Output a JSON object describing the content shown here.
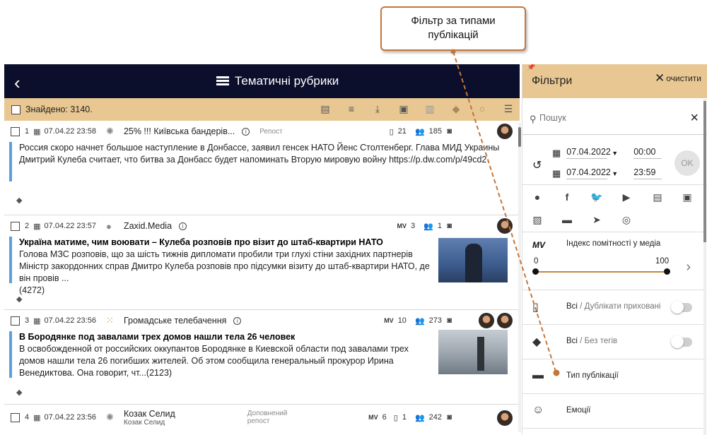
{
  "callout": {
    "line1": "Фільтр за типами",
    "line2": "публікацій"
  },
  "topbar": {
    "back": "‹",
    "title": "Тематичні рубрики"
  },
  "toolbar": {
    "found": "Знайдено: 3140."
  },
  "items": [
    {
      "num": "1",
      "date": "07.04.22 23:58",
      "source": "25% !!! Київська бандерів...",
      "repost": "Репост",
      "stat1": "21",
      "stat2": "185",
      "text": "Россия скоро начнет большое наступление в Донбассе, заявил генсек НАТО Йенс Столтенберг. Глава МИД Украины Дмитрий Кулеба считает, что битва за Донбасс будет напоминать Вторую мировую войну https://p.dw.com/p/49cd2"
    },
    {
      "num": "2",
      "date": "07.04.22 23:57",
      "source": "Zaxid.Media",
      "mv_label": "MV",
      "stat1": "3",
      "stat2": "1",
      "title": "Україна матиме, чим воювати – Кулеба розповів про візит до штаб-квартири НАТО",
      "text": "Голова МЗС розповів, що за шість тижнів дипломати пробили три глухі стіни західних партнерів Міністр закордонних справ Дмитро Кулеба розповів про підсумки візиту до штаб-квартири НАТО, де він провів ...",
      "count": "(4272)"
    },
    {
      "num": "3",
      "date": "07.04.22 23:56",
      "source": "Громадське телебачення",
      "mv_label": "MV",
      "stat1": "10",
      "stat2": "273",
      "title": "В Бородянке под завалами трех домов нашли тела 26 человек",
      "text": "В освобожденной от российских оккупантов Бородянке в Киевской области под завалами трех домов нашли тела 26 погибших жителей. Об этом сообщила генеральный прокурор Ирина Венедиктова. Она говорит, чт...(2123)"
    },
    {
      "num": "4",
      "date": "07.04.22 23:56",
      "source": "Козак Селид",
      "source2": "Козак Селид",
      "repost": "Доповнений",
      "repost2": "репост",
      "mv_label": "MV",
      "stat0": "6",
      "stat1": "1",
      "stat2": "242"
    }
  ],
  "filters": {
    "title": "Фільтри",
    "clear": "очистити",
    "search_placeholder": "Пошук",
    "date_from": "07.04.2022",
    "time_from": "00:00",
    "date_to": "07.04.2022",
    "time_to": "23:59",
    "ok": "OK",
    "mv_badge": "MV",
    "mv_label": "Індекс помітності у медіа",
    "mv_min": "0",
    "mv_max": "100",
    "mv_range": [
      0,
      100
    ],
    "dup_all": "Всі",
    "dup_sub": "/ Дублікати приховані",
    "tags_all": "Всі",
    "tags_sub": "/ Без тегів",
    "pub_type": "Тип публікації",
    "emotions": "Емоції"
  },
  "colors": {
    "accent": "#e8c792",
    "topbar": "#0b0f2c",
    "callout_border": "#c4763a",
    "quote_bar": "#5aa0e0"
  }
}
